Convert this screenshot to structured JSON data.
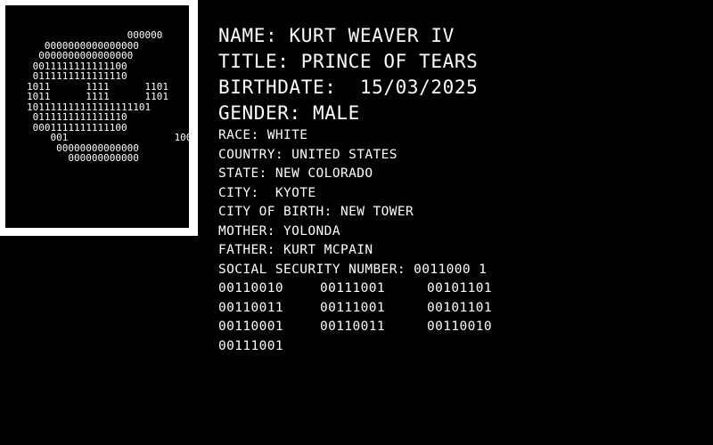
{
  "portrait": {
    "ascii_art": "                 000000\n   0000000000000000\n  0000000000000000\n 0011111111111100\n 0111111111111110\n1011      1111      1101\n1011      1111      1101\n101111111111111111101\n 0111111111111110\n 0001111111111100\n    001                  100\n     00000000000000\n       000000000000"
  },
  "profile": {
    "name": "NAME: KURT WEAVER IV",
    "title": "TITLE: PRINCE OF TEARS",
    "birthdate": "BIRTHDATE:  15/03/2025",
    "gender": "GENDER: MALE",
    "race": "RACE: WHITE",
    "country": "COUNTRY: UNITED STATES",
    "state": "STATE: NEW COLORADO",
    "city": "CITY:  KYOTE",
    "city_of_birth": "CITY OF BIRTH: NEW TOWER",
    "mother": "MOTHER: YOLONDA",
    "father": "FATHER: KURT MCPAIN",
    "ssn_label": "SOCIAL SECURITY NUMBER: 0011000 1"
  },
  "ssn_rows": [
    [
      "00110010",
      "00111001",
      "00101101"
    ],
    [
      "00110011",
      "00111001",
      "00101101"
    ],
    [
      "00110001",
      "00110011",
      "00110010"
    ],
    [
      "00111001"
    ]
  ]
}
